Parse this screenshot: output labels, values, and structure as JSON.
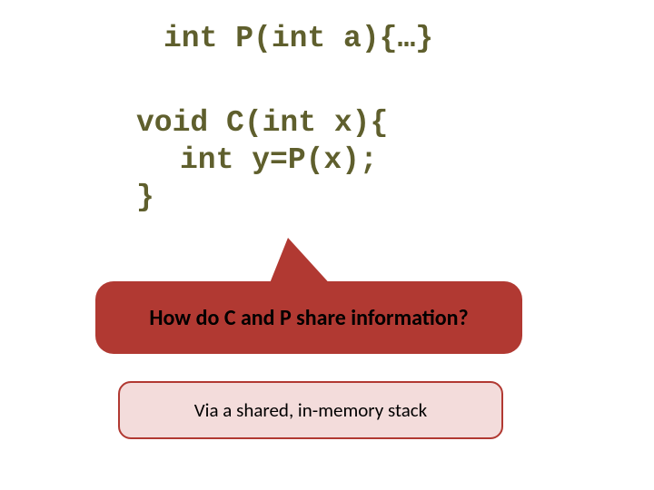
{
  "code": {
    "line1": "int P(int a){…}",
    "line2": "void C(int x){",
    "line3": "int y=P(x);",
    "line4": "}"
  },
  "question": "How do C and P share information?",
  "answer": "Via a shared, in-memory stack",
  "colors": {
    "code_text": "#5f5f2d",
    "bubble_fill": "#b13932",
    "answer_fill": "#f3dcdb",
    "answer_border": "#b13932"
  }
}
